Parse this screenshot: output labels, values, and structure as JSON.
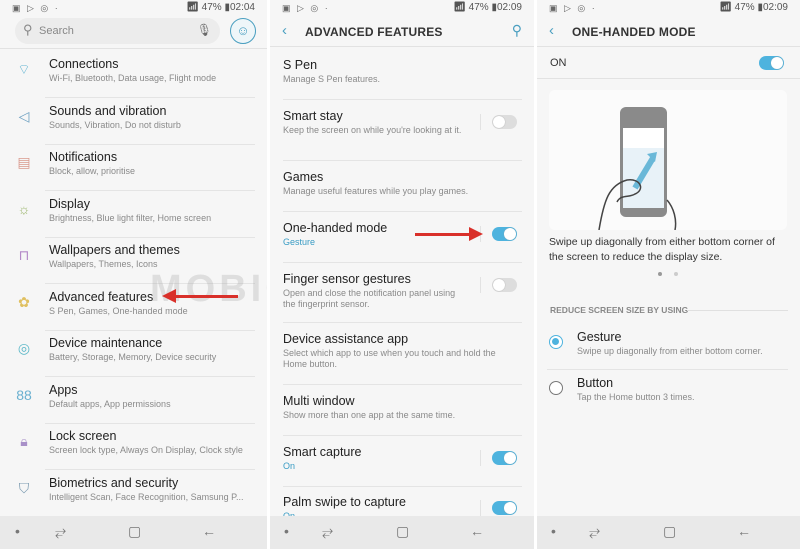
{
  "status_icons": "▣ ▷ ◎ ·",
  "panel1": {
    "battery": "47%",
    "time": "02:04",
    "search_placeholder": "Search",
    "items": [
      {
        "title": "Connections",
        "sub": "Wi-Fi, Bluetooth, Data usage, Flight mode",
        "icon": "connections-icon",
        "glyph": "⌔",
        "color": "#6ab8d4"
      },
      {
        "title": "Sounds and vibration",
        "sub": "Sounds, Vibration, Do not disturb",
        "icon": "speaker-icon",
        "glyph": "◁",
        "color": "#6a9ec0"
      },
      {
        "title": "Notifications",
        "sub": "Block, allow, prioritise",
        "icon": "notifications-icon",
        "glyph": "▤",
        "color": "#d99a8e"
      },
      {
        "title": "Display",
        "sub": "Brightness, Blue light filter, Home screen",
        "icon": "display-icon",
        "glyph": "☼",
        "color": "#9ab56a"
      },
      {
        "title": "Wallpapers and themes",
        "sub": "Wallpapers, Themes, Icons",
        "icon": "brush-icon",
        "glyph": "⊓",
        "color": "#b48ac8"
      },
      {
        "title": "Advanced features",
        "sub": "S Pen, Games, One-handed mode",
        "icon": "advanced-features-icon",
        "glyph": "✿",
        "color": "#e0c060"
      },
      {
        "title": "Device maintenance",
        "sub": "Battery, Storage, Memory, Device security",
        "icon": "maintenance-icon",
        "glyph": "◎",
        "color": "#5cb8c8"
      },
      {
        "title": "Apps",
        "sub": "Default apps, App permissions",
        "icon": "apps-icon",
        "glyph": "88",
        "color": "#6ab0d0"
      },
      {
        "title": "Lock screen",
        "sub": "Screen lock type, Always On Display, Clock style",
        "icon": "lock-icon",
        "glyph": "🔒︎",
        "color": "#a890c8"
      },
      {
        "title": "Biometrics and security",
        "sub": "Intelligent Scan, Face Recognition, Samsung P...",
        "icon": "shield-icon",
        "glyph": "⛉",
        "color": "#7a9ab0"
      }
    ]
  },
  "panel2": {
    "battery": "47%",
    "time": "02:09",
    "title": "ADVANCED FEATURES",
    "items": [
      {
        "title": "S Pen",
        "sub": "Manage S Pen features."
      },
      {
        "title": "Smart stay",
        "sub": "Keep the screen on while you're looking at it.",
        "toggle": false
      },
      {
        "title": "Games",
        "sub": "Manage useful features while you play games."
      },
      {
        "title": "One-handed mode",
        "sub": "Gesture",
        "on": true,
        "toggle": true
      },
      {
        "title": "Finger sensor gestures",
        "sub": "Open and close the notification panel using the fingerprint sensor.",
        "toggle": false
      },
      {
        "title": "Device assistance app",
        "sub": "Select which app to use when you touch and hold the Home button."
      },
      {
        "title": "Multi window",
        "sub": "Show more than one app at the same time."
      },
      {
        "title": "Smart capture",
        "sub": "On",
        "on": true,
        "toggle": true
      },
      {
        "title": "Palm swipe to capture",
        "sub": "On",
        "on": true,
        "toggle": true
      }
    ]
  },
  "panel3": {
    "battery": "47%",
    "time": "02:09",
    "title": "ONE-HANDED MODE",
    "master_label": "ON",
    "master_on": true,
    "description": "Swipe up diagonally from either bottom corner of the screen to reduce the display size.",
    "section": "REDUCE SCREEN SIZE BY USING",
    "options": [
      {
        "title": "Gesture",
        "sub": "Swipe up diagonally from either bottom corner.",
        "selected": true
      },
      {
        "title": "Button",
        "sub": "Tap the Home button 3 times.",
        "selected": false
      }
    ]
  },
  "watermark": "MOBIGYAAN",
  "accent": "#4eb3de",
  "arrow_color": "#d9302a"
}
